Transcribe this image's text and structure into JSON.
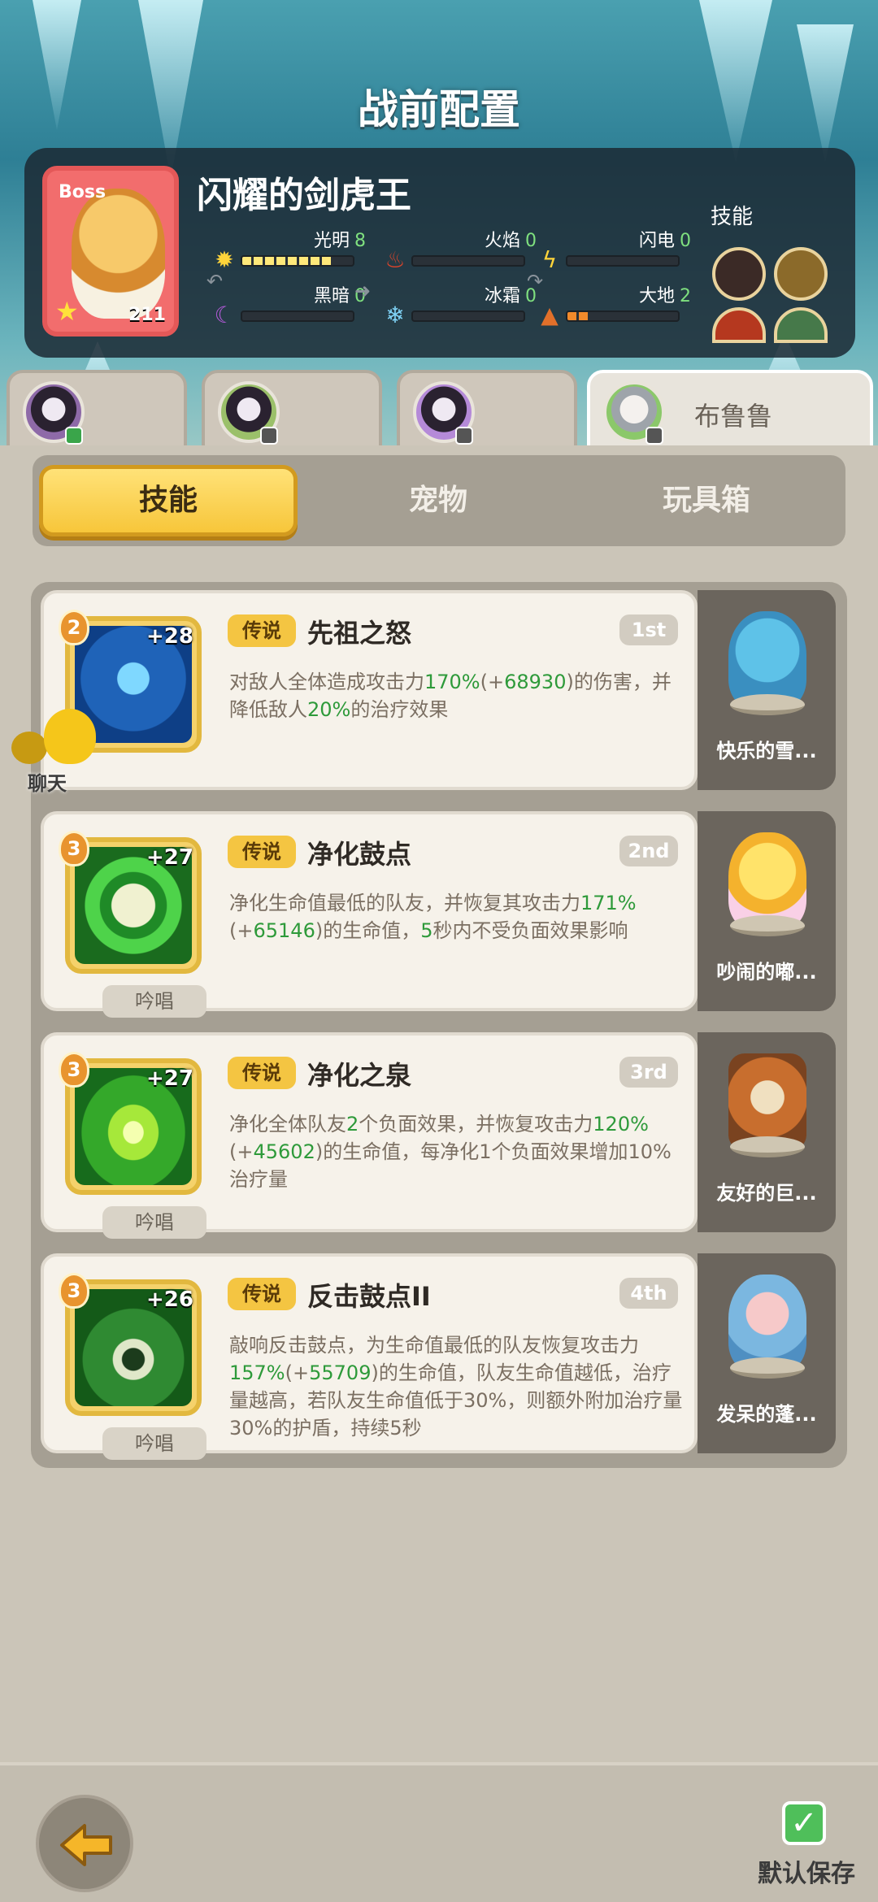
{
  "header": {
    "title": "战前配置"
  },
  "boss": {
    "badge": "Boss",
    "name": "闪耀的剑虎王",
    "level": "211",
    "skills_label": "技能",
    "elements": [
      {
        "name": "光明",
        "value": "8",
        "fill": 0.8,
        "color": "#ffe87a",
        "icon": "sun-icon"
      },
      {
        "name": "火焰",
        "value": "0",
        "fill": 0,
        "color": "#ffe87a",
        "icon": "fire-icon"
      },
      {
        "name": "闪电",
        "value": "0",
        "fill": 0,
        "color": "#ffe87a",
        "icon": "lightning-icon"
      },
      {
        "name": "黑暗",
        "value": "0",
        "fill": 0,
        "color": "#ffe87a",
        "icon": "moon-icon"
      },
      {
        "name": "冰霜",
        "value": "0",
        "fill": 0,
        "color": "#ffe87a",
        "icon": "snowflake-icon"
      },
      {
        "name": "大地",
        "value": "2",
        "fill": 0.2,
        "color": "#f28a2b",
        "icon": "mountain-icon"
      }
    ]
  },
  "hero_tabs": [
    {
      "name": "",
      "active": false
    },
    {
      "name": "",
      "active": false
    },
    {
      "name": "",
      "active": false
    },
    {
      "name": "布鲁鲁",
      "active": true
    }
  ],
  "tabs": [
    {
      "label": "技能",
      "active": true
    },
    {
      "label": "宠物",
      "active": false
    },
    {
      "label": "玩具箱",
      "active": false
    }
  ],
  "skills": [
    {
      "level": "2",
      "plus": "+28",
      "tag": "传说",
      "name": "先祖之怒",
      "rank": "1st",
      "chant": "",
      "desc": [
        "对敌人全体造成攻击力",
        "170%",
        "(+",
        "68930",
        ")的伤害，并降低敌人",
        "20%",
        "的治疗效果"
      ],
      "pet": "快乐的雪...",
      "icon_color": "#2f79c9"
    },
    {
      "level": "3",
      "plus": "+27",
      "tag": "传说",
      "name": "净化鼓点",
      "rank": "2nd",
      "chant": "吟唱",
      "desc": [
        "净化生命值最低的队友，并恢复其攻击力",
        "171%",
        "(+",
        "65146",
        ")的生命值，",
        "5",
        "秒内不受负面效果影响"
      ],
      "pet": "吵闹的嘟...",
      "icon_color": "#2eae36"
    },
    {
      "level": "3",
      "plus": "+27",
      "tag": "传说",
      "name": "净化之泉",
      "rank": "3rd",
      "chant": "吟唱",
      "desc": [
        "净化全体队友",
        "2",
        "个负面效果，并恢复攻击力",
        "120%",
        "(+",
        "45602",
        ")的生命值，每净化1个负面效果增加10%治疗量"
      ],
      "pet": "友好的巨...",
      "icon_color": "#3fae2a"
    },
    {
      "level": "3",
      "plus": "+26",
      "tag": "传说",
      "name": "反击鼓点II",
      "rank": "4th",
      "chant": "吟唱",
      "desc": [
        "敲响反击鼓点，为生命值最低的队友恢复攻击力",
        "157%",
        "(+",
        "55709",
        ")的生命值，队友生命值越低，治疗量越高，若队友生命值低于30%，则额外附加治疗量30%的护盾，持续5秒"
      ],
      "pet": "发呆的蓬...",
      "icon_color": "#2c8a35"
    }
  ],
  "chat": {
    "label": "聊天"
  },
  "footer": {
    "save_label": "默认保存"
  }
}
